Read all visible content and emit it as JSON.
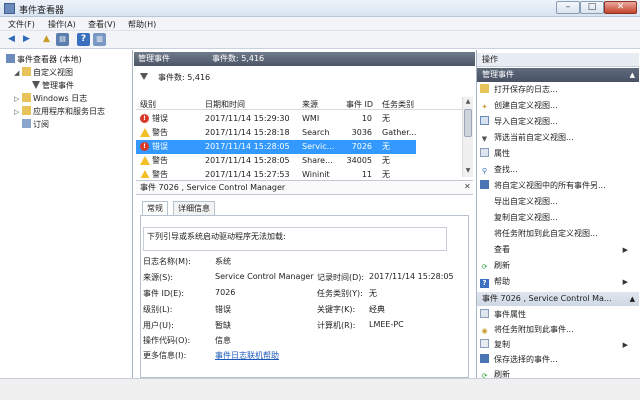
{
  "window": {
    "title": "事件查看器",
    "min": "–",
    "max": "□",
    "close": "✕"
  },
  "menu": [
    "文件(F)",
    "操作(A)",
    "查看(V)",
    "帮助(H)"
  ],
  "tree": {
    "root": "事件查看器 (本地)",
    "custom_views": "自定义视图",
    "admin_events": "管理事件",
    "windows_logs": "Windows 日志",
    "app_logs": "应用程序和服务日志",
    "subscriptions": "订阅"
  },
  "center": {
    "header_title": "管理事件",
    "header_count": "事件数: 5,416",
    "filter_count": "事件数: 5,416",
    "columns": [
      "级别",
      "日期和时间",
      "来源",
      "事件 ID",
      "任务类别"
    ],
    "rows": [
      {
        "icon": "error",
        "level": "错误",
        "datetime": "2017/11/14 15:29:30",
        "source": "WMI",
        "id": "10",
        "task": "无"
      },
      {
        "icon": "warning",
        "level": "警告",
        "datetime": "2017/11/14 15:28:18",
        "source": "Search",
        "id": "3036",
        "task": "Gather..."
      },
      {
        "icon": "error",
        "level": "错误",
        "datetime": "2017/11/14 15:28:05",
        "source": "Servic...",
        "id": "7026",
        "task": "无"
      },
      {
        "icon": "warning",
        "level": "警告",
        "datetime": "2017/11/14 15:28:05",
        "source": "Share...",
        "id": "34005",
        "task": "无"
      },
      {
        "icon": "warning",
        "level": "警告",
        "datetime": "2017/11/14 15:27:53",
        "source": "Wininit",
        "id": "11",
        "task": "无"
      }
    ],
    "detail_title": "事件 7026 , Service Control Manager",
    "tabs": [
      "常规",
      "详细信息"
    ],
    "description": "下列引导或系统启动驱动程序无法加载:",
    "fields": {
      "log_name_label": "日志名称(M):",
      "log_name": "系统",
      "source_label": "来源(S):",
      "source": "Service Control Manager",
      "logged_label": "记录时间(D):",
      "logged": "2017/11/14 15:28:05",
      "event_id_label": "事件 ID(E):",
      "event_id": "7026",
      "task_label": "任务类别(Y):",
      "task": "无",
      "level_label": "级别(L):",
      "level": "错误",
      "keywords_label": "关键字(K):",
      "keywords": "经典",
      "user_label": "用户(U):",
      "user": "暂缺",
      "computer_label": "计算机(R):",
      "computer": "LMEE-PC",
      "opcode_label": "操作代码(O):",
      "opcode": "信息",
      "more_info_label": "更多信息(I):",
      "more_info": "事件日志联机帮助"
    }
  },
  "actions": {
    "title": "操作",
    "section1": "管理事件",
    "items1": [
      "打开保存的日志...",
      "创建自定义视图...",
      "导入自定义视图...",
      "筛选当前自定义视图...",
      "属性",
      "查找...",
      "将自定义视图中的所有事件另...",
      "导出自定义视图...",
      "复制自定义视图...",
      "将任务附加到此自定义视图...",
      "查看",
      "刷新",
      "帮助"
    ],
    "section2": "事件 7026 , Service Control Ma...",
    "items2": [
      "事件属性",
      "将任务附加到此事件...",
      "复制",
      "保存选择的事件...",
      "刷新",
      "帮助"
    ]
  },
  "colors": {
    "selected": "#3399ff",
    "header": "#5a6475",
    "error": "#d83a2a",
    "warning": "#f2c026"
  }
}
